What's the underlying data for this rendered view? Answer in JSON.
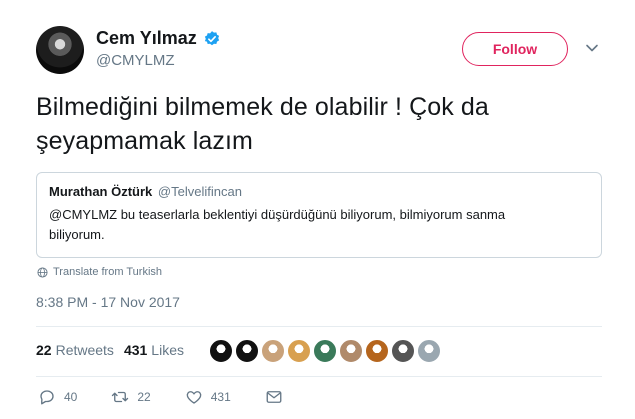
{
  "author": {
    "display_name": "Cem Yılmaz",
    "handle": "@CMYLMZ",
    "verified_icon": "verified-badge-icon",
    "follow_label": "Follow"
  },
  "tweet": {
    "text": "Bilmediğini bilmemek de olabilir ! Çok da şeyapmamak lazım",
    "translate_label": "Translate from Turkish",
    "timestamp": "8:38 PM - 17 Nov 2017"
  },
  "quoted": {
    "name": "Murathan Öztürk",
    "handle": "@Telvelifincan",
    "text": "@CMYLMZ bu teaserlarla beklentiyi düşürdüğünü biliyorum, bilmiyorum sanma biliyorum."
  },
  "stats": {
    "retweets_count": "22",
    "retweets_label": "Retweets",
    "likes_count": "431",
    "likes_label": "Likes"
  },
  "likers": [
    "#111111",
    "#111111",
    "#c9a27a",
    "#d8a050",
    "#3a7a5a",
    "#b08a6a",
    "#b5651d",
    "#555555",
    "#9aa7b0"
  ],
  "actions": {
    "replies": "40",
    "retweets": "22",
    "likes": "431"
  },
  "colors": {
    "follow": "#e0245e",
    "verified": "#1da1f2",
    "secondary_text": "#657786"
  }
}
